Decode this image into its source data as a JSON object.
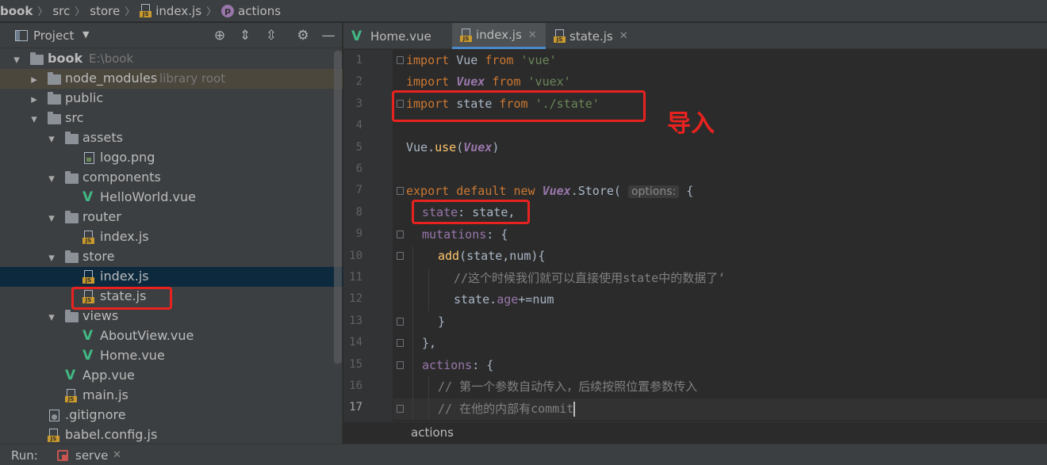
{
  "breadcrumb": [
    "book",
    "src",
    "store",
    "index.js",
    "actions"
  ],
  "breadcrumb_icons": {
    "file": "js-file-icon",
    "symbol": "property-icon"
  },
  "project": {
    "title": "Project",
    "tree": [
      {
        "label": "book",
        "hint": "E:\\book",
        "type": "folder",
        "expanded": true
      },
      {
        "label": "node_modules",
        "hint": "library root",
        "type": "folder",
        "expanded": false
      },
      {
        "label": "public",
        "type": "folder",
        "expanded": false
      },
      {
        "label": "src",
        "type": "folder",
        "expanded": true
      },
      {
        "label": "assets",
        "type": "folder",
        "expanded": true
      },
      {
        "label": "logo.png",
        "type": "image-file"
      },
      {
        "label": "components",
        "type": "folder",
        "expanded": true
      },
      {
        "label": "HelloWorld.vue",
        "type": "vue-file"
      },
      {
        "label": "router",
        "type": "folder",
        "expanded": true
      },
      {
        "label": "index.js",
        "type": "js-file"
      },
      {
        "label": "store",
        "type": "folder",
        "expanded": true
      },
      {
        "label": "index.js",
        "type": "js-file",
        "selected": true
      },
      {
        "label": "state.js",
        "type": "js-file"
      },
      {
        "label": "views",
        "type": "folder",
        "expanded": true
      },
      {
        "label": "AboutView.vue",
        "type": "vue-file"
      },
      {
        "label": "Home.vue",
        "type": "vue-file"
      },
      {
        "label": "App.vue",
        "type": "vue-file"
      },
      {
        "label": "main.js",
        "type": "js-file"
      },
      {
        "label": ".gitignore",
        "type": "git-file"
      },
      {
        "label": "babel.config.js",
        "type": "js-file"
      }
    ]
  },
  "tabs": [
    {
      "label": "Home.vue",
      "icon": "vue-icon"
    },
    {
      "label": "index.js",
      "icon": "js-file-icon",
      "active": true
    },
    {
      "label": "state.js",
      "icon": "js-file-icon"
    }
  ],
  "editor": {
    "current_line": 17,
    "line_numbers": [
      "1",
      "2",
      "3",
      "4",
      "5",
      "6",
      "7",
      "8",
      "9",
      "10",
      "11",
      "12",
      "13",
      "14",
      "15",
      "16",
      "17"
    ],
    "lines": {
      "l1": {
        "kw": "import",
        "mid": " Vue ",
        "kw2": "from",
        "str": "'vue'"
      },
      "l2": {
        "kw": "import",
        "cls": "Vuex",
        "kw2": "from",
        "str": "'vuex'"
      },
      "l3": {
        "kw": "import",
        "mid": " state ",
        "kw2": "from",
        "str": "'./state'"
      },
      "l5": {
        "pre": "Vue.",
        "fn": "use",
        "open": "(",
        "cls": "Vuex",
        "close": ")"
      },
      "l7": {
        "kw": "export default new",
        "cls": "Vuex",
        "mid": ".Store(",
        "hint": "options:",
        "post": "{"
      },
      "l8": {
        "prop": "state",
        "post": ": state,"
      },
      "l9": {
        "prop": "mutations",
        "post": ": {"
      },
      "l10": {
        "fn": "add",
        "post": "(state,num){"
      },
      "l11": {
        "cmt": "//这个时候我们就可以直接使用state中的数据了‘"
      },
      "l12": {
        "pre": "state.",
        "prop": "age",
        "post": "+=num"
      },
      "l13": {
        "post": "}"
      },
      "l14": {
        "post": "},"
      },
      "l15": {
        "prop": "actions",
        "post": ": {"
      },
      "l16": {
        "cmt": "// 第一个参数自动传入，后续按照位置参数传入"
      },
      "l17": {
        "cmt": "// 在他的内部有commit"
      }
    },
    "annotation": "导入",
    "bottom_breadcrumb": "actions"
  },
  "run": {
    "label": "Run:",
    "tab": "serve"
  },
  "colors": {
    "annotation": "#e8231f",
    "selection": "#0d293e",
    "keyword": "#cc7832",
    "string": "#6a8759",
    "property": "#9876aa",
    "function": "#ffc66d",
    "comment": "#808080"
  }
}
